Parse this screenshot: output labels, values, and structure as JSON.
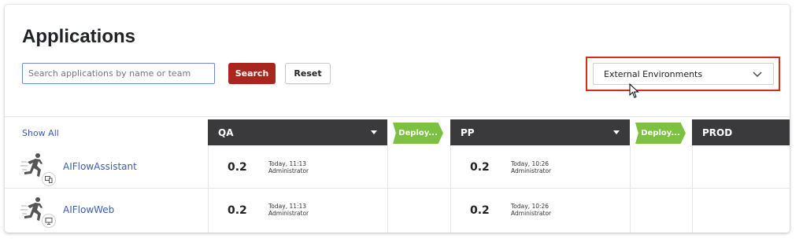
{
  "page": {
    "title": "Applications"
  },
  "search": {
    "placeholder": "Search applications by name or team",
    "value": "",
    "search_label": "Search",
    "reset_label": "Reset"
  },
  "env_filter": {
    "selected": "External Environments"
  },
  "grid": {
    "show_all_label": "Show All",
    "environments": [
      {
        "name": "QA",
        "deploy_label": "Deploy..."
      },
      {
        "name": "PP",
        "deploy_label": "Deploy..."
      },
      {
        "name": "PROD"
      }
    ],
    "rows": [
      {
        "app": "AIFlowAssistant",
        "device_icon": "desktop-mobile-icon",
        "deployments": [
          {
            "env": "QA",
            "version": "0.2",
            "time": "Today, 11:13",
            "user": "Administrator"
          },
          {
            "env": "PP",
            "version": "0.2",
            "time": "Today, 10:26",
            "user": "Administrator"
          }
        ]
      },
      {
        "app": "AIFlowWeb",
        "device_icon": "desktop-icon",
        "deployments": [
          {
            "env": "QA",
            "version": "0.2",
            "time": "Today, 11:13",
            "user": "Administrator"
          },
          {
            "env": "PP",
            "version": "0.2",
            "time": "Today, 10:26",
            "user": "Administrator"
          }
        ]
      }
    ]
  },
  "colors": {
    "primary_button": "#a8261d",
    "deploy_tag": "#7cc142",
    "env_header": "#3a3a3d",
    "link": "#3b5cb8",
    "highlight": "#d62c1f"
  }
}
